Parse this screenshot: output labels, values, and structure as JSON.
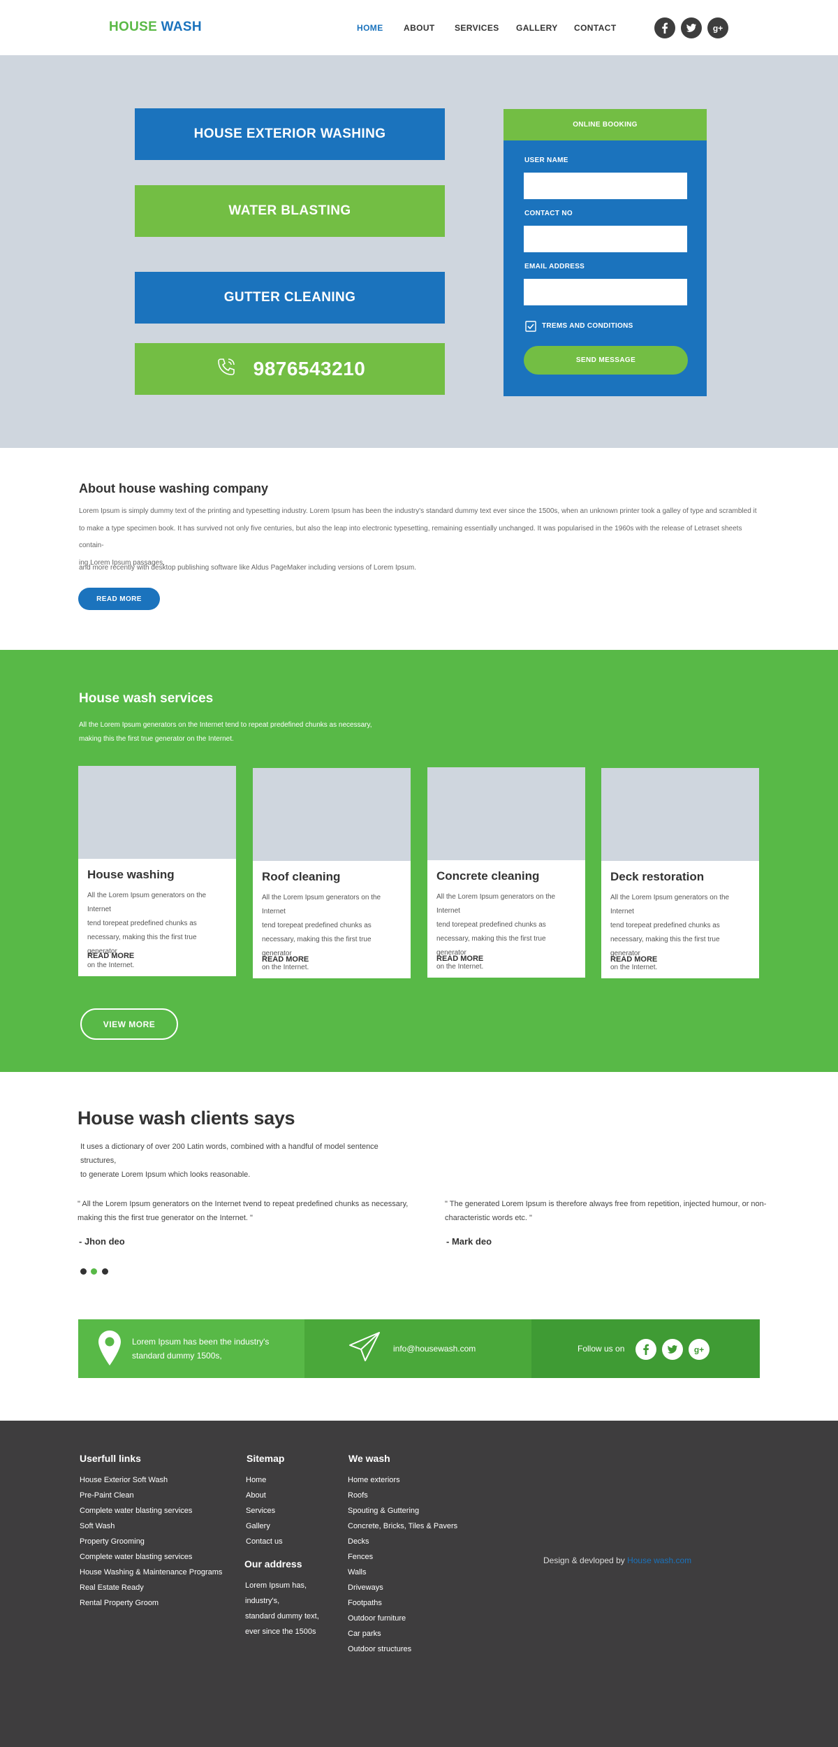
{
  "header": {
    "logo_part1": "HOUSE",
    "logo_part2": "WASH",
    "nav": [
      "HOME",
      "ABOUT",
      "SERVICES",
      "GALLERY",
      "CONTACT"
    ],
    "active_nav": "HOME",
    "social_icons": [
      "facebook-icon",
      "twitter-icon",
      "google-plus-icon"
    ]
  },
  "hero": {
    "buttons": [
      "HOUSE EXTERIOR WASHING",
      "WATER BLASTING",
      "GUTTER CLEANING"
    ],
    "phone": "9876543210",
    "booking": {
      "title": "ONLINE BOOKING",
      "fields": [
        {
          "label": "USER NAME",
          "value": "",
          "placeholder": ""
        },
        {
          "label": "CONTACT NO",
          "value": "",
          "placeholder": ""
        },
        {
          "label": "EMAIL ADDRESS",
          "value": "",
          "placeholder": ""
        }
      ],
      "terms": "TREMS AND CONDITIONS",
      "terms_checked": true,
      "submit": "SEND MESSAGE"
    }
  },
  "about": {
    "title": "About house washing company",
    "p1_lines": [
      "Lorem Ipsum is simply dummy text of the printing and typesetting industry. Lorem Ipsum has been the industry's standard dummy text ever since the 1500s, when an unknown printer took a galley of type and scrambled it",
      "to make a type specimen book. It has survived not only five centuries, but also the leap into electronic typesetting, remaining essentially unchanged. It was popularised in the 1960s with the release of Letraset sheets contain-",
      "ing Lorem Ipsum passages,"
    ],
    "p2": "and more recently with desktop publishing software like Aldus PageMaker including versions of Lorem Ipsum.",
    "button": "READ MORE"
  },
  "services": {
    "title": "House wash services",
    "desc_lines": [
      "All the Lorem Ipsum generators on the Internet tend to repeat predefined chunks as necessary,",
      "making this the first true generator on the Internet."
    ],
    "cards": [
      {
        "title": "House washing",
        "text_lines": [
          "All the Lorem Ipsum generators on the Internet",
          "tend torepeat predefined chunks as",
          "necessary, making this the first true generator",
          "on the Internet."
        ],
        "link": "READ MORE"
      },
      {
        "title": "Roof cleaning",
        "text_lines": [
          "All the Lorem Ipsum generators on the Internet",
          "tend torepeat predefined chunks as",
          "necessary, making this the first true generator",
          "on the Internet."
        ],
        "link": "READ MORE"
      },
      {
        "title": "Concrete cleaning",
        "text_lines": [
          "All the Lorem Ipsum generators on the Internet",
          "tend torepeat predefined chunks as",
          "necessary, making this the first true generator",
          "on the Internet."
        ],
        "link": "READ MORE"
      },
      {
        "title": "Deck restoration",
        "text_lines": [
          "All the Lorem Ipsum generators on the Internet",
          "tend torepeat predefined chunks as",
          "necessary, making this the first true generator",
          "on the Internet."
        ],
        "link": "READ MORE"
      }
    ],
    "view_more": "VIEW MORE"
  },
  "testimonials": {
    "title": "House wash clients says",
    "intro_lines": [
      "It uses a dictionary of over 200 Latin words, combined with a handful of model sentence structures,",
      "to generate Lorem Ipsum which looks reasonable."
    ],
    "quotes": [
      {
        "text_lines": [
          "\" All the Lorem Ipsum generators on the Internet tvend to repeat predefined chunks as necessary,",
          "making this the first true generator on the Internet. \""
        ],
        "author": "- Jhon deo"
      },
      {
        "text_lines": [
          "\"  The generated Lorem Ipsum is therefore always free from repetition, injected humour, or non-",
          "characteristic words etc. \""
        ],
        "author": "- Mark deo"
      }
    ],
    "dots": 3,
    "active_dot": 2
  },
  "contact_bar": {
    "address_lines": [
      "Lorem Ipsum has been the industry's",
      "standard dummy 1500s,"
    ],
    "email": "info@housewash.com",
    "follow": "Follow us on",
    "social_icons": [
      "facebook-icon",
      "twitter-icon",
      "google-plus-icon"
    ]
  },
  "footer": {
    "useful_links_title": "Userfull links",
    "useful_links": [
      "House Exterior Soft Wash",
      "Pre-Paint Clean",
      "Complete water blasting services",
      "Soft Wash",
      "Property Grooming",
      "Complete water blasting services",
      "House Washing & Maintenance Programs",
      "Real Estate Ready",
      "Rental Property Groom"
    ],
    "sitemap_title": "Sitemap",
    "sitemap": [
      "Home",
      "About",
      "Services",
      "Gallery",
      "Contact us"
    ],
    "address_title": "Our address",
    "address_lines": [
      "Lorem Ipsum has,",
      "industry's,",
      "standard dummy text,",
      "ever since the 1500s"
    ],
    "we_wash_title": "We wash",
    "we_wash": [
      "Home exteriors",
      "Roofs",
      "Spouting & Guttering",
      "Concrete, Bricks, Tiles & Pavers",
      "Decks",
      "Fences",
      "Walls",
      "Driveways",
      "Footpaths",
      "Outdoor furniture",
      "Car parks",
      "Outdoor structures"
    ],
    "credit_prefix": "Design & devloped by",
    "credit_link": "House wash.com"
  },
  "colors": {
    "brand_blue": "#1b73bd",
    "brand_green": "#5ab946",
    "services_green": "#58b947",
    "footer_dark": "#3e3d3e"
  }
}
